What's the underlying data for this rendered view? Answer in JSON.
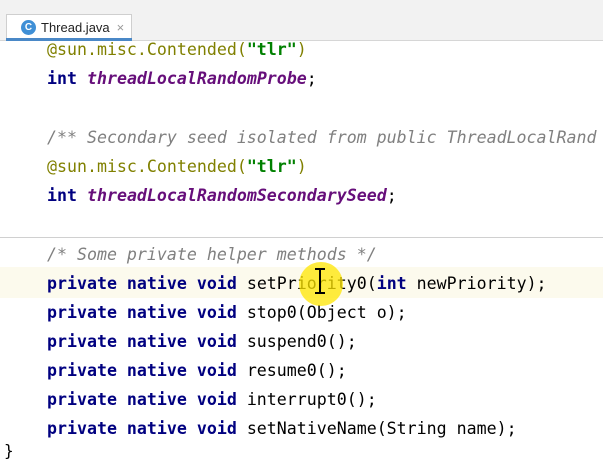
{
  "tab": {
    "icon": "java-class-icon",
    "icon_letter": "C",
    "label": "Thread.java",
    "close": "×"
  },
  "code": {
    "l1": {
      "ann": "@sun.misc.Contended(",
      "str": "\"tlr\"",
      "end": ")"
    },
    "l2": {
      "kw": "int",
      "field": "threadLocalRandomProbe",
      "end": ";"
    },
    "l3": {
      "comment": "/** Secondary seed isolated from public ThreadLocalRand"
    },
    "l4": {
      "ann": "@sun.misc.Contended(",
      "str": "\"tlr\"",
      "end": ")"
    },
    "l5": {
      "kw": "int",
      "field": "threadLocalRandomSecondarySeed",
      "end": ";"
    },
    "l6": {
      "comment": "/* Some private helper methods */"
    },
    "l7": {
      "kw": "private native void",
      "name": "setPriority0(",
      "kw2": "int",
      "rest": " newPriority);"
    },
    "l8": {
      "kw": "private native void",
      "rest": " stop0(Object o);"
    },
    "l9": {
      "kw": "private native void",
      "rest": " suspend0();"
    },
    "l10": {
      "kw": "private native void",
      "rest": " resume0();"
    },
    "l11": {
      "kw": "private native void",
      "rest": " interrupt0();"
    },
    "l12": {
      "kw": "private native void",
      "rest": " setNativeName(String name);"
    },
    "closing": "}"
  },
  "colors": {
    "keyword": "#000080",
    "field": "#660e7a",
    "annotation": "#808000",
    "string": "#008000",
    "comment": "#808080",
    "cursor_highlight": "#ffe600"
  }
}
